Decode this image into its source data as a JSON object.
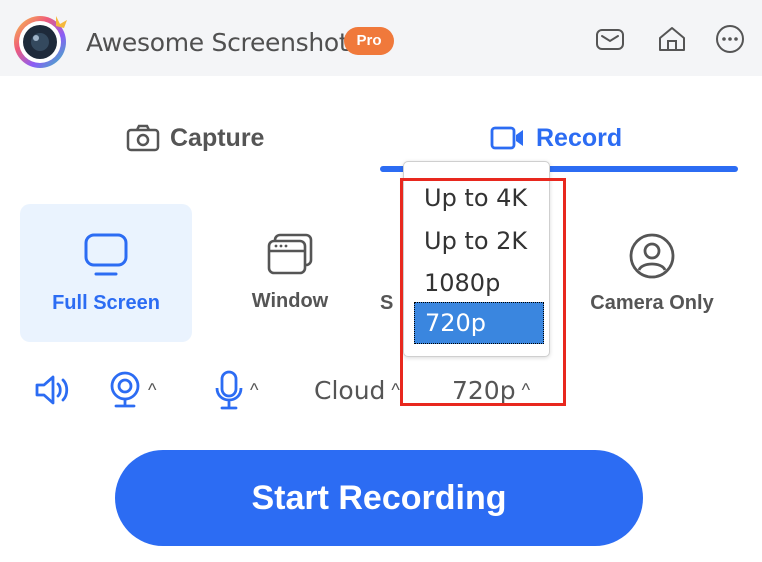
{
  "header": {
    "app_name": "Awesome Screenshot",
    "badge": "Pro",
    "icons": [
      "mail-icon",
      "home-icon",
      "more-icon"
    ]
  },
  "tabs": [
    {
      "label": "Capture",
      "icon": "camera-icon",
      "active": false
    },
    {
      "label": "Record",
      "icon": "video-icon",
      "active": true
    }
  ],
  "modes": [
    {
      "label": "Full Screen",
      "icon": "monitor-icon",
      "selected": true
    },
    {
      "label": "Window",
      "icon": "window-icon",
      "selected": false
    },
    {
      "label": "S",
      "icon": "region-icon",
      "selected": false
    },
    {
      "label": "Camera Only",
      "icon": "user-icon",
      "selected": false
    }
  ],
  "settings": {
    "audio_icon": "speaker-icon",
    "camera_icon": "webcam-icon",
    "mic_icon": "microphone-icon",
    "storage": "Cloud",
    "resolution": "720p"
  },
  "resolution_dropdown": {
    "options": [
      "Up to 4K",
      "Up to 2K",
      "1080p",
      "720p"
    ],
    "selected": "720p"
  },
  "start_button": "Start Recording",
  "colors": {
    "accent": "#2c6cf3",
    "badge": "#f0793b",
    "highlight": "#e8281e",
    "selected_mode_bg": "#eaf3fe"
  }
}
